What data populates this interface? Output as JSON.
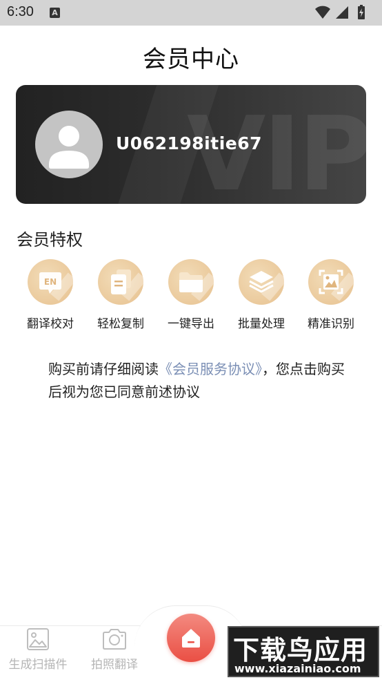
{
  "status_bar": {
    "time": "6:30",
    "notification_icon": "A"
  },
  "page": {
    "title": "会员中心"
  },
  "vip_card": {
    "watermark": "VIP",
    "username": "U062198itie67"
  },
  "privileges": {
    "title": "会员特权",
    "items": [
      {
        "label": "翻译校对",
        "icon": "translate-bubble-icon",
        "icon_text": "EN"
      },
      {
        "label": "轻松复制",
        "icon": "copy-icon"
      },
      {
        "label": "一键导出",
        "icon": "folder-icon"
      },
      {
        "label": "批量处理",
        "icon": "layers-icon"
      },
      {
        "label": "精准识别",
        "icon": "image-scan-icon"
      }
    ]
  },
  "agreement": {
    "prefix": "购买前请仔细阅读",
    "link": "《会员服务协议》",
    "suffix": "，您点击购买后视为您已同意前述协议"
  },
  "bottom_nav": {
    "items": [
      {
        "label": "生成扫描件",
        "icon": "image-icon"
      },
      {
        "label": "拍照翻译",
        "icon": "camera-icon"
      }
    ],
    "center_icon": "home-icon"
  },
  "site_watermark": {
    "brand": "下载鸟应用",
    "url": "www.xiazainiao.com"
  },
  "colors": {
    "accent_gold": "#e7c18f",
    "link_blue": "#7b8fb5",
    "center_red": "#ea4f44",
    "card_dark": "#2a2a2a"
  }
}
